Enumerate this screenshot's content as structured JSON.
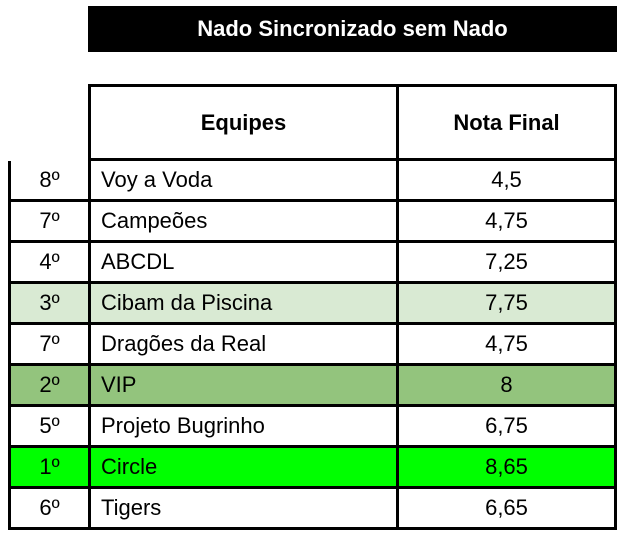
{
  "title": "Nado Sincronizado sem Nado",
  "headers": {
    "team": "Equipes",
    "score": "Nota Final"
  },
  "rows": [
    {
      "rank": "8º",
      "team": "Voy a Voda",
      "score": "4,5",
      "bg": "#ffffff"
    },
    {
      "rank": "7º",
      "team": "Campeões",
      "score": "4,75",
      "bg": "#ffffff"
    },
    {
      "rank": "4º",
      "team": "ABCDL",
      "score": "7,25",
      "bg": "#ffffff"
    },
    {
      "rank": "3º",
      "team": "Cibam da Piscina",
      "score": "7,75",
      "bg": "#d9ead3"
    },
    {
      "rank": "7º",
      "team": "Dragões da Real",
      "score": "4,75",
      "bg": "#ffffff"
    },
    {
      "rank": "2º",
      "team": "VIP",
      "score": "8",
      "bg": "#93c47d"
    },
    {
      "rank": "5º",
      "team": "Projeto Bugrinho",
      "score": "6,75",
      "bg": "#ffffff"
    },
    {
      "rank": "1º",
      "team": "Circle",
      "score": "8,65",
      "bg": "#00ff00"
    },
    {
      "rank": "6º",
      "team": "Tigers",
      "score": "6,65",
      "bg": "#ffffff"
    }
  ]
}
